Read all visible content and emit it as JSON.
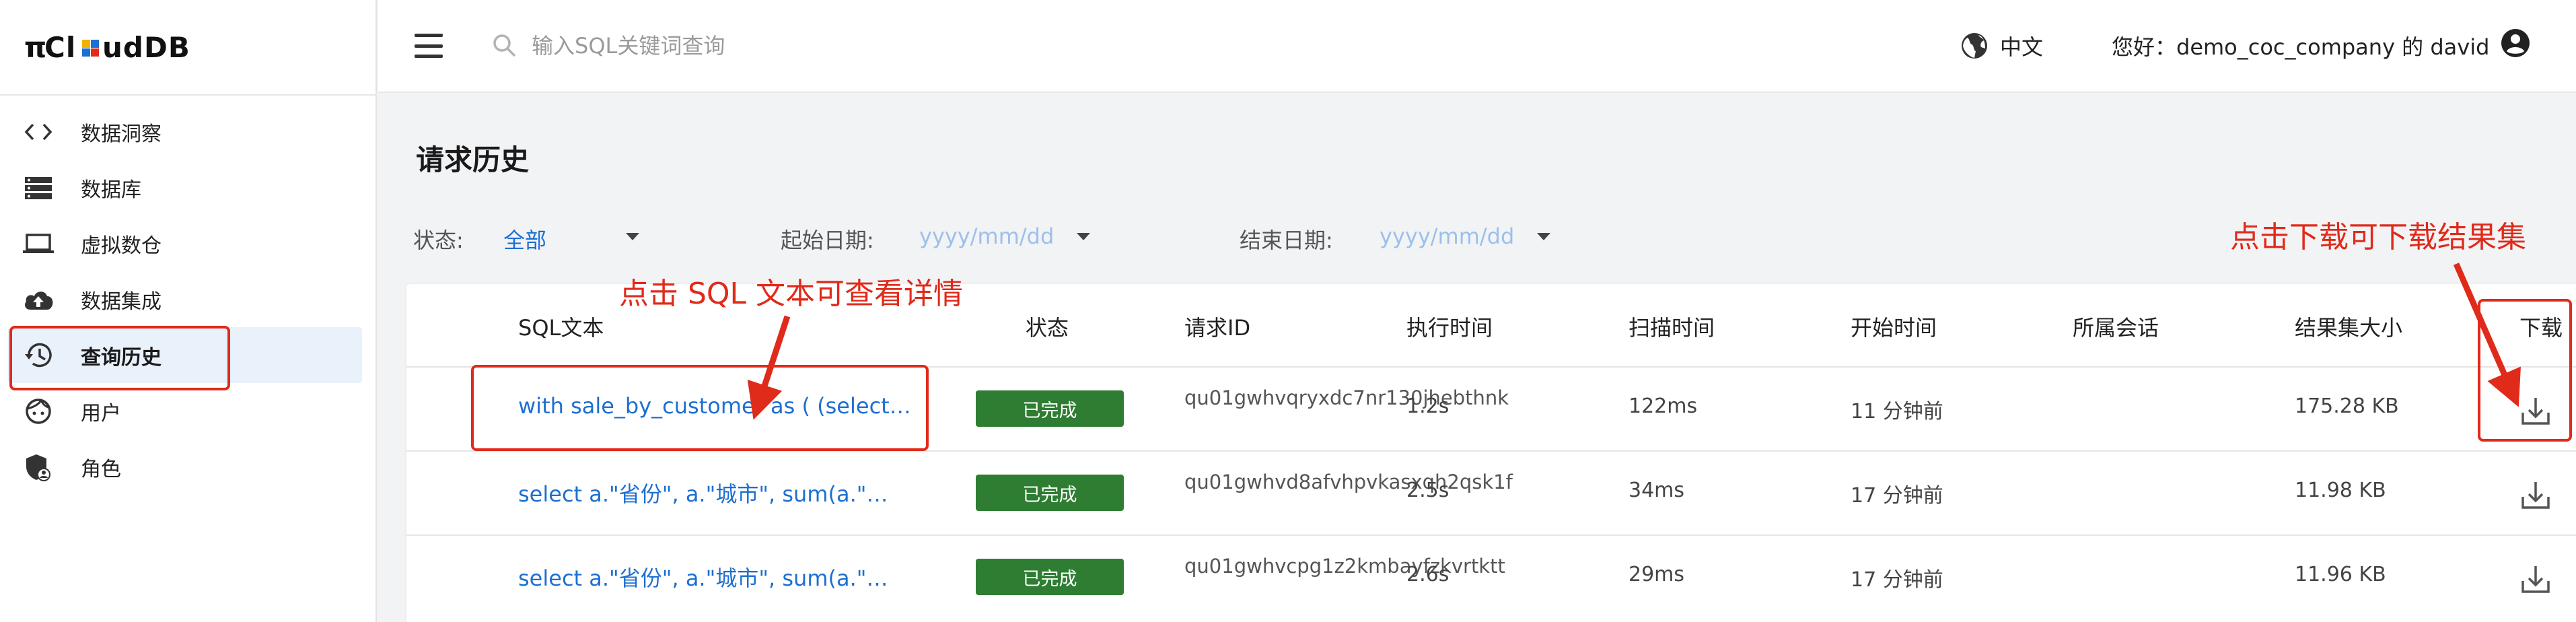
{
  "app": {
    "logo_text": "πCloudDB"
  },
  "sidebar": {
    "items": [
      {
        "label": "数据洞察",
        "icon": "code-icon"
      },
      {
        "label": "数据库",
        "icon": "database-icon"
      },
      {
        "label": "虚拟数仓",
        "icon": "laptop-icon"
      },
      {
        "label": "数据集成",
        "icon": "cloud-upload-icon"
      },
      {
        "label": "查询历史",
        "icon": "history-icon",
        "active": true
      },
      {
        "label": "用户",
        "icon": "user-face-icon"
      },
      {
        "label": "角色",
        "icon": "shield-user-icon"
      }
    ]
  },
  "topbar": {
    "search_placeholder": "输入SQL关键词查询",
    "language": "中文",
    "greeting": "您好：demo_coc_company 的 david"
  },
  "page": {
    "title": "请求历史",
    "filters": {
      "status_label": "状态:",
      "status_value": "全部",
      "start_label": "起始日期:",
      "start_placeholder": "yyyy/mm/dd",
      "end_label": "结束日期:",
      "end_placeholder": "yyyy/mm/dd"
    }
  },
  "annotations": {
    "sql_hint": "点击 SQL 文本可查看详情",
    "download_hint": "点击下载可下载结果集"
  },
  "table": {
    "columns": [
      "SQL文本",
      "状态",
      "请求ID",
      "执行时间",
      "扫描时间",
      "开始时间",
      "所属会话",
      "结果集大小",
      "下载"
    ],
    "rows": [
      {
        "sql": "with sale_by_customer as ( (select…",
        "status": "已完成",
        "request_id": "qu01gwhvqryxdc7nr130jhebthnk",
        "exec_time": "1.2s",
        "scan_time": "122ms",
        "start_time": "11 分钟前",
        "session": "",
        "result_size": "175.28 KB"
      },
      {
        "sql": "select a.\"省份\", a.\"城市\", sum(a.\"…",
        "status": "已完成",
        "request_id": "qu01gwhvd8afvhpvkasxqh2qsk1f",
        "exec_time": "2.5s",
        "scan_time": "34ms",
        "start_time": "17 分钟前",
        "session": "",
        "result_size": "11.98 KB"
      },
      {
        "sql": "select a.\"省份\", a.\"城市\", sum(a.\"…",
        "status": "已完成",
        "request_id": "qu01gwhvcpg1z2kmbayfzkvrtktt",
        "exec_time": "2.6s",
        "scan_time": "29ms",
        "start_time": "17 分钟前",
        "session": "",
        "result_size": "11.96 KB"
      }
    ]
  },
  "colors": {
    "accent": "#1d6fd1",
    "status_done": "#2e7d32",
    "annotation": "#e02a1a"
  }
}
